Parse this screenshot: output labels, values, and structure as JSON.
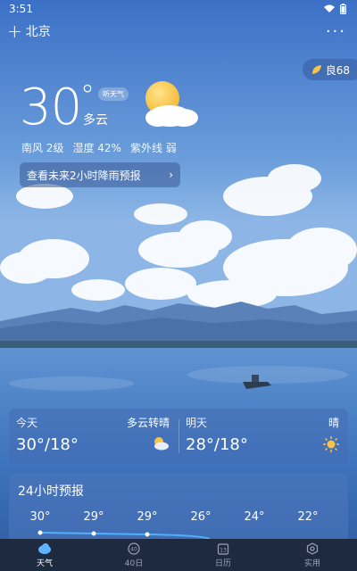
{
  "status": {
    "time": "3:51"
  },
  "header": {
    "city": "北京",
    "plus": "+",
    "more": "···"
  },
  "aqi": {
    "label": "良68"
  },
  "current": {
    "temp": "30",
    "deg": "°",
    "listen": "听天气",
    "condition": "多云",
    "wind": "南风 2级",
    "humidity": "湿度 42%",
    "uv": "紫外线 弱"
  },
  "rain_banner": {
    "text": "查看未来2小时降雨预报",
    "arrow": "›"
  },
  "days": [
    {
      "name": "今天",
      "condition": "多云转晴",
      "range": "30°/18°",
      "icon": "cloud-sun-icon"
    },
    {
      "name": "明天",
      "condition": "晴",
      "range": "28°/18°",
      "icon": "sun-icon"
    }
  ],
  "hourly": {
    "title": "24小时预报",
    "temps": [
      "30°",
      "29°",
      "29°",
      "26°",
      "24°",
      "22°"
    ]
  },
  "nav": [
    {
      "label": "天气",
      "icon": "weather-icon",
      "active": true
    },
    {
      "label": "40日",
      "icon": "calendar-40-icon",
      "active": false
    },
    {
      "label": "日历",
      "icon": "calendar-icon",
      "active": false
    },
    {
      "label": "实用",
      "icon": "tools-icon",
      "active": false
    }
  ],
  "nav_icon_glyphs": {
    "calendar-40": "40",
    "calendar": "13"
  },
  "colors": {
    "sky_top": "#3d72c8",
    "sky_mid": "#6ea0dc",
    "water": "#4a7fc2",
    "nav_bg": "#1e2a40",
    "sun": "#f7c447"
  }
}
